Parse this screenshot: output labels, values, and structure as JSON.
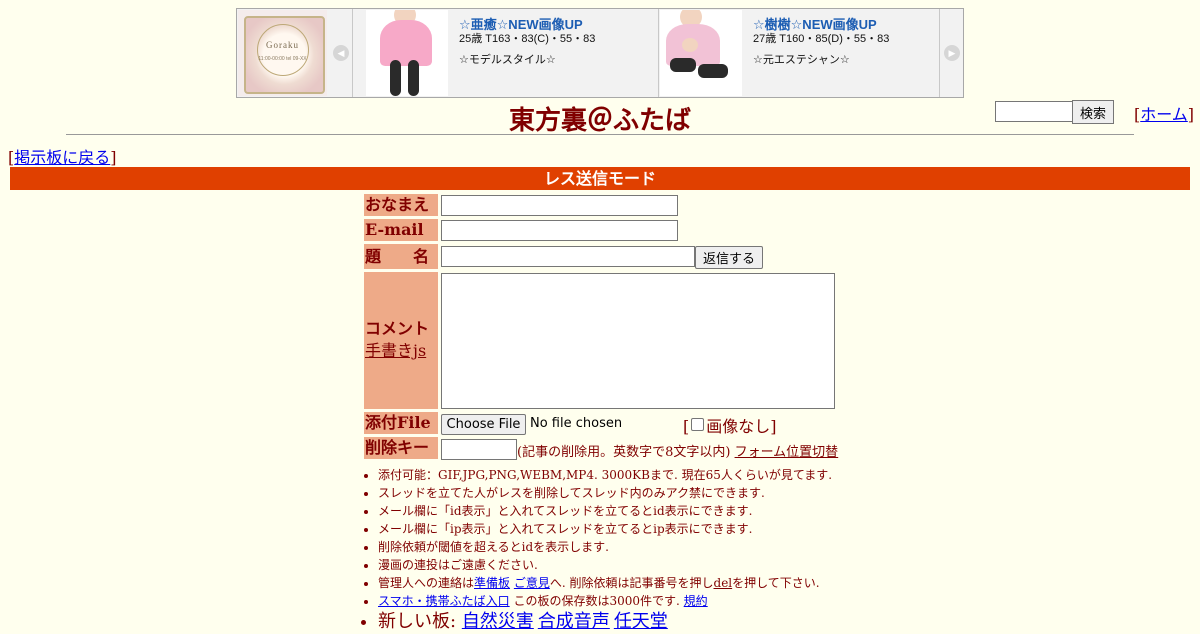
{
  "banner": {
    "logo_name": "Goraku",
    "logo_sub": "11:00-00:00 tel 09-XX",
    "cards": [
      {
        "title": "☆亜癒☆NEW画像UP",
        "stats": "25歳 T163・83(C)・55・83",
        "tagline": "☆モデルスタイル☆"
      },
      {
        "title": "☆樹樹☆NEW画像UP",
        "stats": "27歳 T160・85(D)・55・83",
        "tagline": "☆元エステシャン☆"
      }
    ],
    "prev_icon": "◀",
    "next_icon": "▶"
  },
  "header": {
    "title": "東方裏＠ふたば",
    "search_button": "検索",
    "home_link": "ホーム",
    "back_link": "掲示板に戻る",
    "bracket_open": "[",
    "bracket_close": "]"
  },
  "mode_bar": "レス送信モード",
  "form": {
    "name_label": "おなまえ",
    "email_label": "E-mail",
    "subject_label": "題　　名",
    "submit_button": "返信する",
    "comment_label": "コメント",
    "drawing_link": "手書きjs",
    "file_label": "添付File",
    "choose_file_button": "Choose File",
    "file_status": "No file chosen",
    "no_image_label": "画像なし",
    "delete_key_label": "削除キー",
    "delete_key_note": "(記事の削除用。英数字で8文字以内)",
    "form_toggle_link": "フォーム位置切替"
  },
  "notes": {
    "n1": "添付可能：GIF,JPG,PNG,WEBM,MP4. 3000KBまで. 現在65人くらいが見てます.",
    "n2": "スレッドを立てた人がレスを削除してスレッド内のみアク禁にできます.",
    "n3": "メール欄に「id表示」と入れてスレッドを立てるとid表示にできます.",
    "n4": "メール欄に「ip表示」と入れてスレッドを立てるとip表示にできます.",
    "n5": "削除依頼が閾値を超えるとidを表示します.",
    "n6": "漫画の連投はご遠慮ください.",
    "n7_a": "管理人への連絡は",
    "n7_link1": "準備板",
    "n7_link2": "ご意見",
    "n7_b": "へ. 削除依頼は記事番号を押し",
    "n7_link3": "del",
    "n7_c": "を押して下さい.",
    "n8_link1": "スマホ・携帯ふたば入口",
    "n8_text": "この板の保存数は3000件です.",
    "n8_link2": "規約",
    "n9_label": "新しい板:",
    "n9_boards": [
      "自然災害",
      "合成音声",
      "任天堂"
    ]
  },
  "colors": {
    "background": "#ffffee",
    "text": "#800000",
    "label_bg": "#eeaa88",
    "mode_bar": "#e04000",
    "card_title": "#1c5db3"
  }
}
